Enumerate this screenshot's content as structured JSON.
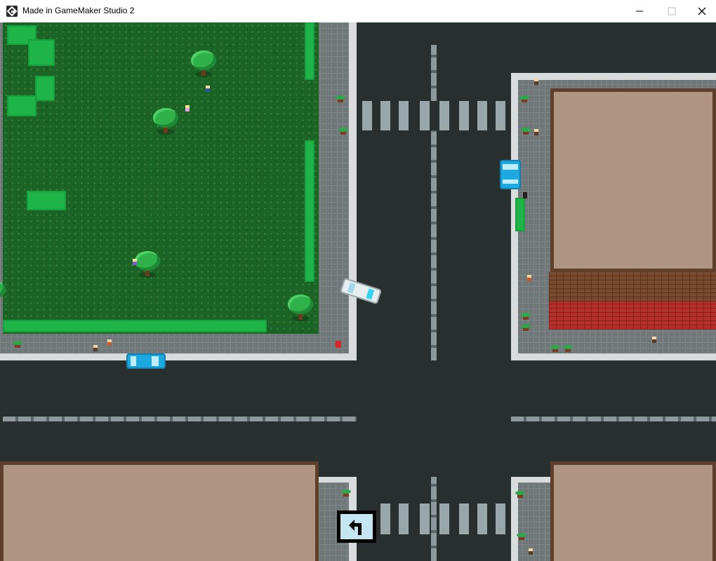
{
  "window": {
    "title": "Made in GameMaker Studio 2",
    "icon": "gamemaker-icon",
    "controls": [
      "minimize",
      "maximize",
      "close"
    ]
  },
  "scene": {
    "type": "top-down city intersection",
    "colors": {
      "road": "#27302f",
      "grass": "#1c6326",
      "hedge": "#1fb447",
      "sidewalk": "#6f7778",
      "roof": "#b19583",
      "roof_border": "#5e3f2b",
      "brick_brown": "#7a4a2e",
      "brick_red": "#b5302a",
      "car_blue": "#1ea8e0",
      "car_white": "#e7eef0"
    },
    "vehicles": [
      {
        "name": "blue-car-east-road",
        "color": "#1ea8e0",
        "heading": "south"
      },
      {
        "name": "blue-car-left-road",
        "color": "#1ea8e0",
        "heading": "west"
      },
      {
        "name": "white-car-intersection",
        "color": "#e7eef0",
        "heading": "east"
      }
    ],
    "sign": {
      "icon": "left-turn-arrow-icon"
    }
  }
}
